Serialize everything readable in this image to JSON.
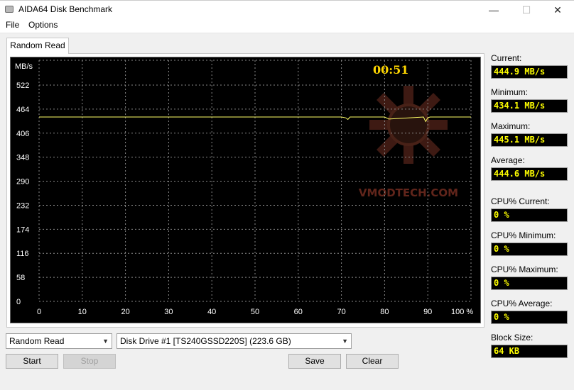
{
  "window": {
    "title": "AIDA64 Disk Benchmark",
    "min_glyph": "—",
    "max_glyph": "☐",
    "close_glyph": "✕"
  },
  "menu": [
    "File",
    "Options"
  ],
  "tab": {
    "label": "Random Read"
  },
  "chart_data": {
    "type": "line",
    "ylabel": "MB/s",
    "y_ticks": [
      "522",
      "464",
      "406",
      "348",
      "290",
      "232",
      "174",
      "116",
      "58",
      "0"
    ],
    "x_ticks": [
      "0",
      "10",
      "20",
      "30",
      "40",
      "50",
      "60",
      "70",
      "80",
      "90",
      "100 %"
    ],
    "ylim": [
      0,
      580
    ],
    "xlim": [
      0,
      100
    ],
    "grid": true,
    "timer": "00:51",
    "watermark": "VMODTECH.COM",
    "series": [
      {
        "color": "#ffff66",
        "x": [
          0,
          10,
          20,
          30,
          50,
          70,
          71,
          71.5,
          72,
          78,
          80,
          81,
          89,
          89.5,
          90,
          90.5,
          91,
          100
        ],
        "y": [
          445,
          445,
          445,
          445,
          445,
          445,
          443,
          439,
          445,
          445,
          445,
          440,
          445,
          434,
          443,
          445,
          445,
          445
        ]
      }
    ]
  },
  "stats": {
    "current_label": "Current:",
    "current": "444.9 MB/s",
    "minimum_label": "Minimum:",
    "minimum": "434.1 MB/s",
    "maximum_label": "Maximum:",
    "maximum": "445.1 MB/s",
    "average_label": "Average:",
    "average": "444.6 MB/s",
    "cpu_current_label": "CPU% Current:",
    "cpu_current": "0 %",
    "cpu_minimum_label": "CPU% Minimum:",
    "cpu_minimum": "0 %",
    "cpu_maximum_label": "CPU% Maximum:",
    "cpu_maximum": "0 %",
    "cpu_average_label": "CPU% Average:",
    "cpu_average": "0 %",
    "block_size_label": "Block Size:",
    "block_size": "64 KB"
  },
  "controls": {
    "test_select": "Random Read",
    "drive_select": "Disk Drive #1  [TS240GSSD220S]  (223.6 GB)",
    "start": "Start",
    "stop": "Stop",
    "save": "Save",
    "clear": "Clear"
  }
}
